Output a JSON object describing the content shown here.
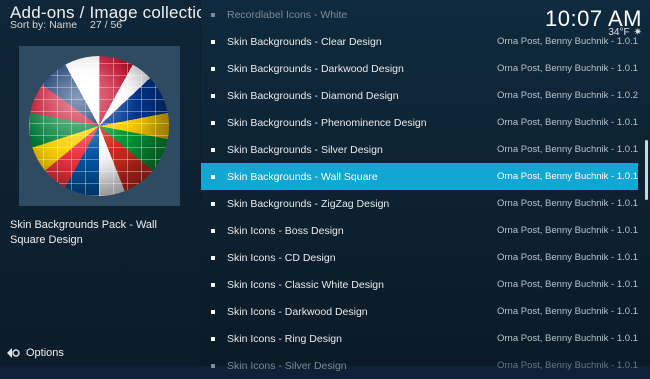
{
  "header": {
    "title": "Add-ons / Image collections",
    "sort_label": "Sort by: Name",
    "position": "27 / 56"
  },
  "clock": {
    "time": "10:07 AM",
    "temperature": "34°F",
    "weather_icon": "sun-icon"
  },
  "selected_addon": {
    "description": "Skin Backgrounds Pack - Wall Square Design",
    "thumbnail_icon": "flag-globe-image"
  },
  "footer": {
    "options_label": "Options",
    "options_icon": "options-menu-icon"
  },
  "colors": {
    "selected_row": "#12a6d2",
    "background": "#0d2236"
  },
  "list": [
    {
      "name": "Recordlabel Icons - White",
      "meta": "",
      "state": "faded"
    },
    {
      "name": "Skin Backgrounds - Clear Design",
      "meta": "Orna Post, Benny Buchnik - 1.0.1",
      "state": ""
    },
    {
      "name": "Skin Backgrounds - Darkwood Design",
      "meta": "Orna Post, Benny Buchnik - 1.0.1",
      "state": ""
    },
    {
      "name": "Skin Backgrounds - Diamond Design",
      "meta": "Orna Post, Benny Buchnik - 1.0.2",
      "state": ""
    },
    {
      "name": "Skin Backgrounds - Phenominence Design",
      "meta": "Orna Post, Benny Buchnik - 1.0.1",
      "state": ""
    },
    {
      "name": "Skin Backgrounds - Silver Design",
      "meta": "Orna Post, Benny Buchnik - 1.0.1",
      "state": ""
    },
    {
      "name": "Skin Backgrounds - Wall Square",
      "meta": "Orna Post, Benny Buchnik - 1.0.1",
      "state": "selected"
    },
    {
      "name": "Skin Backgrounds - ZigZag Design",
      "meta": "Orna Post, Benny Buchnik - 1.0.1",
      "state": ""
    },
    {
      "name": "Skin Icons - Boss Design",
      "meta": "Orna Post, Benny Buchnik - 1.0.1",
      "state": ""
    },
    {
      "name": "Skin Icons - CD Design",
      "meta": "Orna Post, Benny Buchnik - 1.0.1",
      "state": ""
    },
    {
      "name": "Skin Icons - Classic White Design",
      "meta": "Orna Post, Benny Buchnik - 1.0.1",
      "state": ""
    },
    {
      "name": "Skin Icons - Darkwood Design",
      "meta": "Orna Post, Benny Buchnik - 1.0.1",
      "state": ""
    },
    {
      "name": "Skin Icons - Ring Design",
      "meta": "Orna Post, Benny Buchnik - 1.0.1",
      "state": ""
    },
    {
      "name": "Skin Icons - Silver Design",
      "meta": "Orna Post, Benny Buchnik - 1.0.1",
      "state": "faded"
    }
  ]
}
